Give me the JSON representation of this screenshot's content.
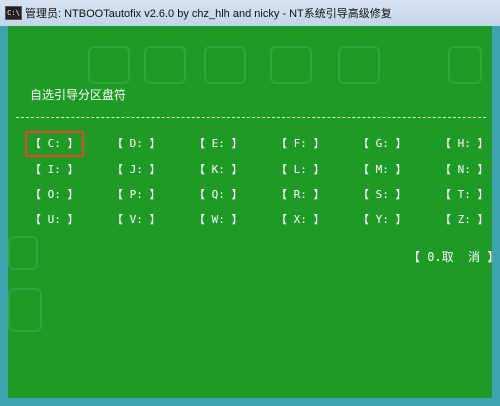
{
  "window": {
    "icon_text": "C:\\",
    "title": "管理员:  NTBOOTautofix v2.6.0 by chz_hlh and nicky - NT系统引导高级修复"
  },
  "dialog": {
    "heading": "自选引导分区盘符",
    "drives": [
      {
        "label": "【 C: 】",
        "selected": true
      },
      {
        "label": "【 D: 】",
        "selected": false
      },
      {
        "label": "【 E: 】",
        "selected": false
      },
      {
        "label": "【 F: 】",
        "selected": false
      },
      {
        "label": "【 G: 】",
        "selected": false
      },
      {
        "label": "【 H: 】",
        "selected": false
      },
      {
        "label": "【 I: 】",
        "selected": false
      },
      {
        "label": "【 J: 】",
        "selected": false
      },
      {
        "label": "【 K: 】",
        "selected": false
      },
      {
        "label": "【 L: 】",
        "selected": false
      },
      {
        "label": "【 M: 】",
        "selected": false
      },
      {
        "label": "【 N: 】",
        "selected": false
      },
      {
        "label": "【 O: 】",
        "selected": false
      },
      {
        "label": "【 P: 】",
        "selected": false
      },
      {
        "label": "【 Q: 】",
        "selected": false
      },
      {
        "label": "【 R: 】",
        "selected": false
      },
      {
        "label": "【 S: 】",
        "selected": false
      },
      {
        "label": "【 T: 】",
        "selected": false
      },
      {
        "label": "【 U: 】",
        "selected": false
      },
      {
        "label": "【 V: 】",
        "selected": false
      },
      {
        "label": "【 W: 】",
        "selected": false
      },
      {
        "label": "【 X: 】",
        "selected": false
      },
      {
        "label": "【 Y: 】",
        "selected": false
      },
      {
        "label": "【 Z: 】",
        "selected": false
      }
    ],
    "cancel_label": "【 0.取  消 】"
  },
  "colors": {
    "background": "#1e9a26",
    "text": "#ffffff",
    "selection": "#e8452a"
  }
}
